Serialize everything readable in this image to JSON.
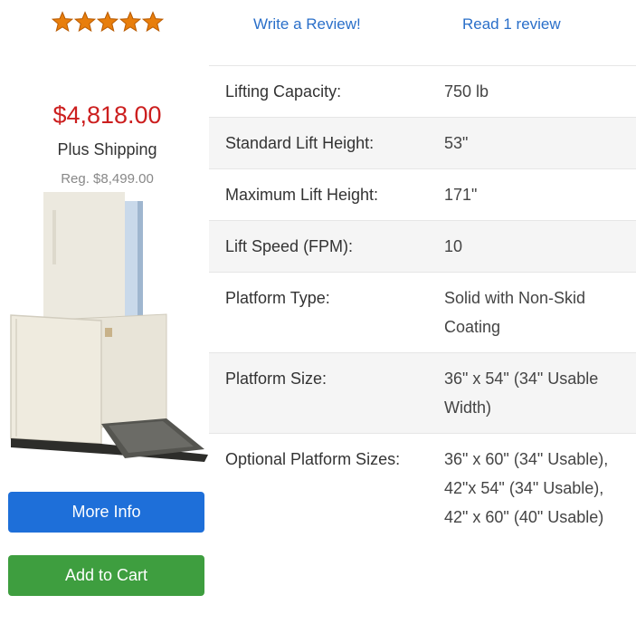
{
  "rating": {
    "stars": 5,
    "max": 5,
    "color": "#e87e0c"
  },
  "links": {
    "write_review": "Write a Review!",
    "read_reviews": "Read 1 review"
  },
  "pricing": {
    "price": "$4,818.00",
    "shipping": "Plus Shipping",
    "regular": "Reg. $8,499.00"
  },
  "buttons": {
    "more_info": "More Info",
    "add_to_cart": "Add to Cart"
  },
  "specs": [
    {
      "label": "Lifting Capacity:",
      "value": "750 lb"
    },
    {
      "label": "Standard Lift Height:",
      "value": "53\""
    },
    {
      "label": "Maximum Lift Height:",
      "value": "171\""
    },
    {
      "label": "Lift Speed (FPM):",
      "value": "10"
    },
    {
      "label": "Platform Type:",
      "value": "Solid with Non-Skid Coating"
    },
    {
      "label": "Platform Size:",
      "value": "36\" x 54\" (34\" Usable Width)"
    },
    {
      "label": "Optional Platform Sizes:",
      "value": "36\" x 60\" (34\" Usable), 42\"x 54\" (34\" Usable), 42\" x 60\" (40\" Usable)"
    }
  ],
  "colors": {
    "price": "#cc1f1f",
    "link": "#2a6fc9",
    "more_info_bg": "#1e6fd9",
    "add_to_cart_bg": "#3e9e3f"
  }
}
